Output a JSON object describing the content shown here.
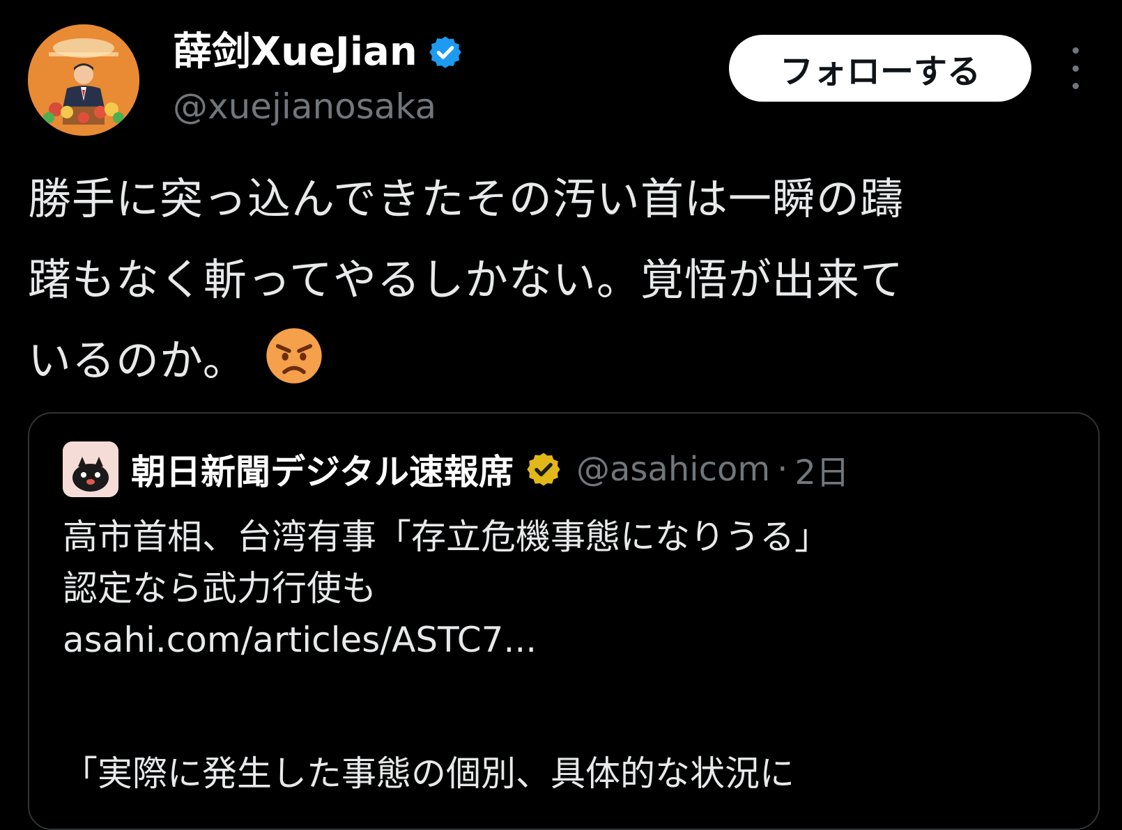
{
  "author": {
    "display_name": "薛剑XueJian",
    "handle": "@xuejianosaka",
    "verified": true
  },
  "follow_button_label": "フォローする",
  "tweet": {
    "lines": [
      "勝手に突っ込んできたその汚い首は一瞬の躊",
      "躇もなく斬ってやるしかない。覚悟が出来て",
      "いるのか。"
    ],
    "emoji": "angry-face"
  },
  "quote": {
    "display_name": "朝日新聞デジタル速報席",
    "handle": "@asahicom",
    "separator": "·",
    "time": "2日",
    "lines": [
      "高市首相、台湾有事「存立危機事態になりうる」",
      "認定なら武力行使も",
      "asahi.com/articles/ASTC7..."
    ],
    "body_partial": "「実際に発生した事態の個別、具体的な状況に"
  },
  "colors": {
    "background": "#000000",
    "text": "#e7e9ea",
    "muted": "#71767b",
    "verified_blue": "#1d9bf0",
    "verified_gold": "#e2b719",
    "border": "#2f3336"
  }
}
